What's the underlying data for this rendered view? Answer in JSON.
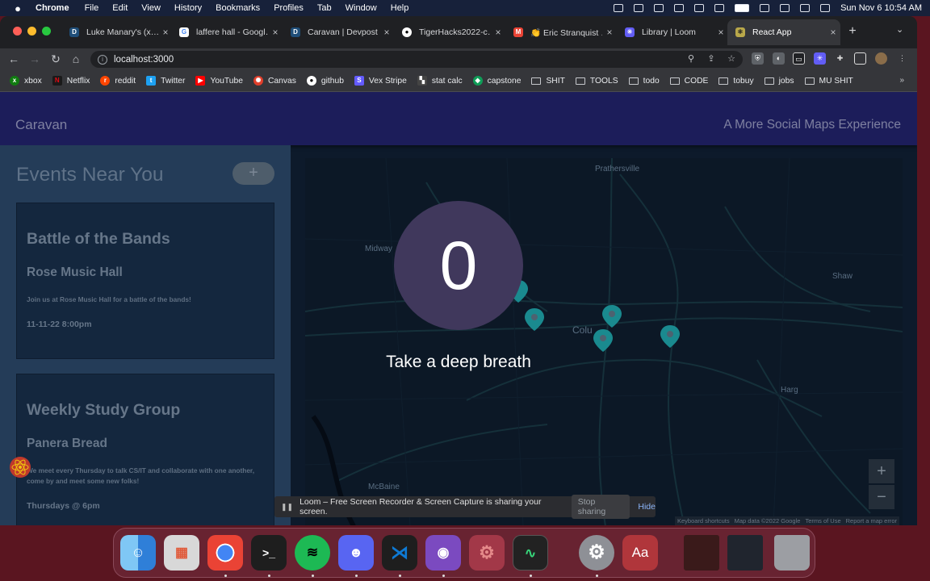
{
  "menubar": {
    "items": [
      "Chrome",
      "File",
      "Edit",
      "View",
      "History",
      "Bookmarks",
      "Profiles",
      "Tab",
      "Window",
      "Help"
    ],
    "clock": "Sun Nov 6  10:54 AM"
  },
  "tabs": [
    {
      "title": "Luke Manary's (x…",
      "icon": "devpost-icon",
      "color": "#1f4e79"
    },
    {
      "title": "laffere hall - Googl…",
      "icon": "google-icon",
      "color": "#ffffff"
    },
    {
      "title": "Caravan | Devpost",
      "icon": "devpost-icon",
      "color": "#1f4e79"
    },
    {
      "title": "TigerHacks2022-c…",
      "icon": "github-icon",
      "color": "#ffffff"
    },
    {
      "title": "👏 Eric Stranquist …",
      "icon": "gmail-icon",
      "color": "#ea4335"
    },
    {
      "title": "Library | Loom",
      "icon": "loom-icon",
      "color": "#625df5"
    },
    {
      "title": "React App",
      "icon": "react-icon",
      "color": "#61dafb"
    }
  ],
  "omnibox": {
    "url": "localhost:3000"
  },
  "bookmarks": [
    {
      "label": "xbox",
      "kind": "icon",
      "color": "#107c10"
    },
    {
      "label": "Netflix",
      "kind": "icon",
      "color": "#e50914"
    },
    {
      "label": "reddit",
      "kind": "icon",
      "color": "#ff4500"
    },
    {
      "label": "Twitter",
      "kind": "icon",
      "color": "#1da1f2"
    },
    {
      "label": "YouTube",
      "kind": "icon",
      "color": "#ff0000"
    },
    {
      "label": "Canvas",
      "kind": "icon",
      "color": "#e13f2b"
    },
    {
      "label": "github",
      "kind": "icon",
      "color": "#333333"
    },
    {
      "label": "Vex Stripe",
      "kind": "icon",
      "color": "#635bff"
    },
    {
      "label": "stat calc",
      "kind": "icon",
      "color": "#444444"
    },
    {
      "label": "capstone",
      "kind": "icon",
      "color": "#0f9d58"
    },
    {
      "label": "SHIT",
      "kind": "folder"
    },
    {
      "label": "TOOLS",
      "kind": "folder"
    },
    {
      "label": "todo",
      "kind": "folder"
    },
    {
      "label": "CODE",
      "kind": "folder"
    },
    {
      "label": "tobuy",
      "kind": "folder"
    },
    {
      "label": "jobs",
      "kind": "folder"
    },
    {
      "label": "MU SHIT",
      "kind": "folder"
    }
  ],
  "app": {
    "brand": "Caravan",
    "tagline": "A More Social Maps Experience",
    "sidebar_title": "Events Near You",
    "add_label": "+",
    "events": [
      {
        "title": "Battle of the Bands",
        "venue": "Rose Music Hall",
        "description": "Join us at Rose Music Hall for a battle of the bands!",
        "datetime": "11-11-22 8:00pm"
      },
      {
        "title": "Weekly Study Group",
        "venue": "Panera Bread",
        "description": "We meet every Thursday to talk CS/IT and collaborate with one another, come by and meet some new folks!",
        "datetime": "Thursdays @ 6pm"
      }
    ]
  },
  "map": {
    "labels": [
      "Prathersville",
      "Midway",
      "Shaw",
      "Colu",
      "Harg",
      "McBaine"
    ],
    "zoom_in": "+",
    "zoom_out": "−",
    "attribution": [
      "Keyboard shortcuts",
      "Map data ©2022 Google",
      "Terms of Use",
      "Report a map error"
    ],
    "marker_color": "#1a8a8f"
  },
  "breath_overlay": {
    "count": "0",
    "message": "Take a deep breath"
  },
  "loom_bar": {
    "pause_icon": "pause-icon",
    "message": "Loom – Free Screen Recorder & Screen Capture is sharing your screen.",
    "stop_label": "Stop sharing",
    "hide_label": "Hide"
  },
  "dock": {
    "apps": [
      {
        "name": "finder",
        "glyph": "☺",
        "color": "#3c9ef0"
      },
      {
        "name": "launchpad",
        "glyph": "▦",
        "color": "#d7d7d7"
      },
      {
        "name": "chrome",
        "glyph": "●",
        "color": "#e8453c"
      },
      {
        "name": "terminal",
        "glyph": ">_",
        "color": "#1e1e1e"
      },
      {
        "name": "spotify",
        "glyph": "≋",
        "color": "#1db954"
      },
      {
        "name": "discord",
        "glyph": "☻",
        "color": "#5865f2"
      },
      {
        "name": "vscode",
        "glyph": "⋊",
        "color": "#0e7ad4"
      },
      {
        "name": "github-desktop",
        "glyph": "◉",
        "color": "#7b4ac0"
      },
      {
        "name": "settings-gear",
        "glyph": "⚙",
        "color": "#a23848"
      },
      {
        "name": "activity-monitor",
        "glyph": "∿",
        "color": "#222222"
      },
      {
        "name": "system-preferences",
        "glyph": "⚙",
        "color": "#8e9096"
      },
      {
        "name": "dictionary",
        "glyph": "Aa",
        "color": "#b0363b"
      },
      {
        "name": "screenshot-thumb-1",
        "glyph": "",
        "color": "#3a1a1a"
      },
      {
        "name": "screenshot-thumb-2",
        "glyph": "",
        "color": "#20252e"
      },
      {
        "name": "trash",
        "glyph": "🗑",
        "color": "#9c9ea3"
      }
    ]
  }
}
